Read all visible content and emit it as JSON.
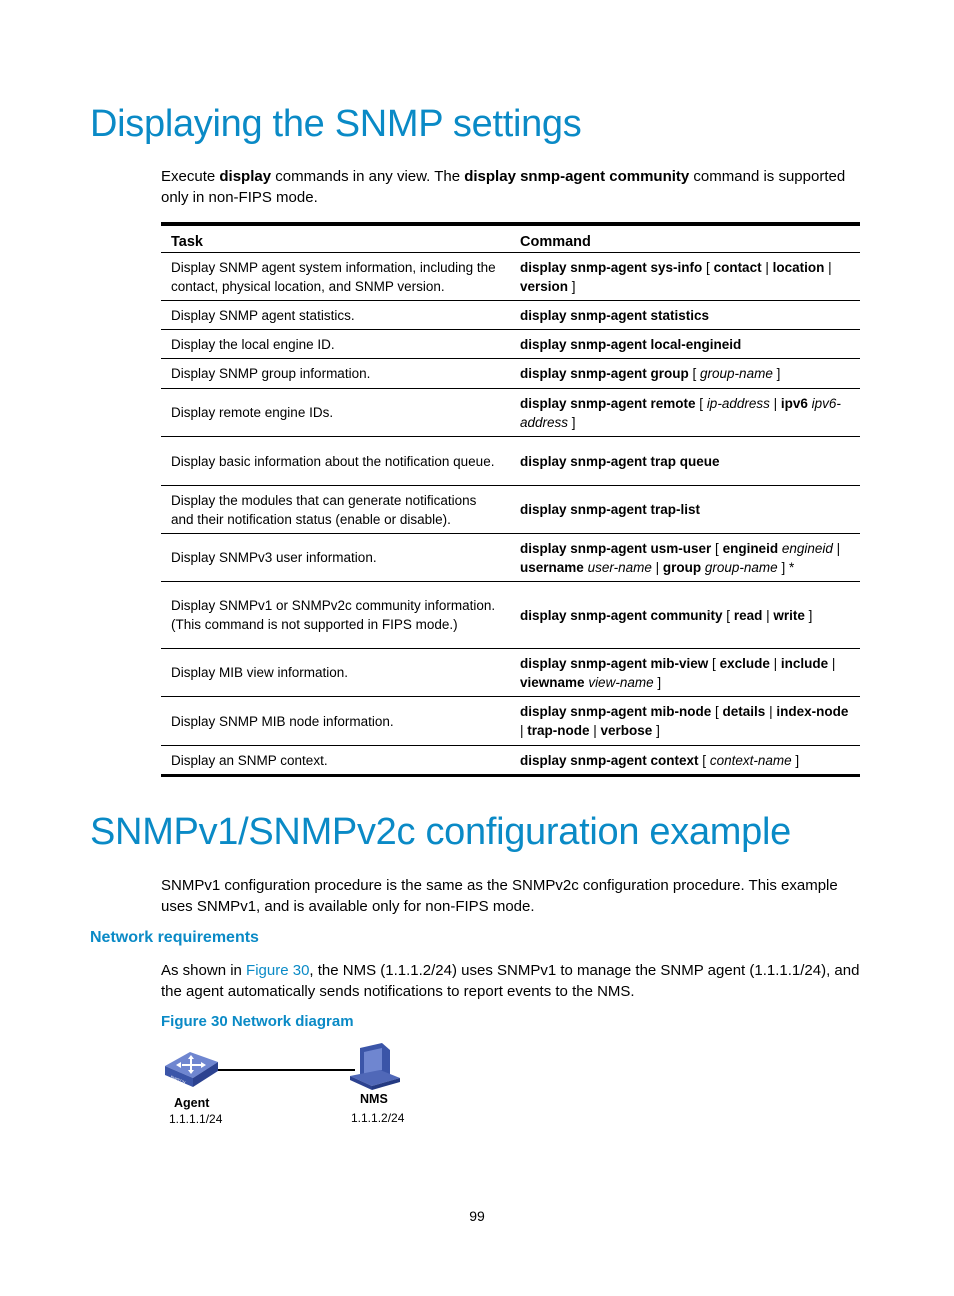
{
  "section1": {
    "title": "Displaying the SNMP settings",
    "intro": {
      "p1": "Execute ",
      "b1": "display",
      "p2": " commands in any view. The ",
      "b2": "display snmp-agent community",
      "p3": " command is supported only in non-FIPS mode."
    },
    "table": {
      "headers": [
        "Task",
        "Command"
      ],
      "rows": [
        {
          "task": "Display SNMP agent system information, including the contact, physical location, and SNMP version.",
          "cmd": [
            [
              "b",
              "display snmp-agent sys-info"
            ],
            [
              "t",
              " [ "
            ],
            [
              "b",
              "contact"
            ],
            [
              "t",
              " | "
            ],
            [
              "b",
              "location"
            ],
            [
              "t",
              " | "
            ],
            [
              "b",
              "version"
            ],
            [
              "t",
              " ]"
            ]
          ]
        },
        {
          "task": "Display SNMP agent statistics.",
          "cmd": [
            [
              "b",
              "display snmp-agent statistics"
            ]
          ]
        },
        {
          "task": "Display the local engine ID.",
          "cmd": [
            [
              "b",
              "display snmp-agent local-engineid"
            ]
          ]
        },
        {
          "task": "Display SNMP group information.",
          "cmd": [
            [
              "b",
              "display snmp-agent group"
            ],
            [
              "t",
              " [ "
            ],
            [
              "i",
              "group-name"
            ],
            [
              "t",
              " ]"
            ]
          ]
        },
        {
          "task": "Display remote engine IDs.",
          "cmd": [
            [
              "b",
              "display snmp-agent remote"
            ],
            [
              "t",
              " [ "
            ],
            [
              "i",
              "ip-address"
            ],
            [
              "t",
              " | "
            ],
            [
              "b",
              "ipv6"
            ],
            [
              "t",
              " "
            ],
            [
              "i",
              "ipv6-address"
            ],
            [
              "t",
              " ]"
            ]
          ]
        },
        {
          "task": "Display basic information about the notification queue.",
          "cmd": [
            [
              "b",
              "display snmp-agent trap queue"
            ]
          ]
        },
        {
          "task": "Display the modules that can generate notifications and their notification status (enable or disable).",
          "cmd": [
            [
              "b",
              "display snmp-agent trap-list"
            ]
          ]
        },
        {
          "task": "Display SNMPv3 user information.",
          "cmd": [
            [
              "b",
              "display snmp-agent usm-user"
            ],
            [
              "t",
              " [ "
            ],
            [
              "b",
              "engineid"
            ],
            [
              "t",
              " "
            ],
            [
              "i",
              "engineid"
            ],
            [
              "t",
              " | "
            ],
            [
              "b",
              "username"
            ],
            [
              "t",
              " "
            ],
            [
              "i",
              "user-name"
            ],
            [
              "t",
              " | "
            ],
            [
              "b",
              "group"
            ],
            [
              "t",
              " "
            ],
            [
              "i",
              "group-name"
            ],
            [
              "t",
              " ] *"
            ]
          ]
        },
        {
          "task": "Display SNMPv1 or SNMPv2c community information. (This command is not supported in FIPS mode.)",
          "cmd": [
            [
              "b",
              "display snmp-agent community"
            ],
            [
              "t",
              " [ "
            ],
            [
              "b",
              "read"
            ],
            [
              "t",
              " | "
            ],
            [
              "b",
              "write"
            ],
            [
              "t",
              " ]"
            ]
          ]
        },
        {
          "task": "Display MIB view information.",
          "cmd": [
            [
              "b",
              "display snmp-agent mib-view"
            ],
            [
              "t",
              " [ "
            ],
            [
              "b",
              "exclude"
            ],
            [
              "t",
              " | "
            ],
            [
              "b",
              "include"
            ],
            [
              "t",
              " | "
            ],
            [
              "b",
              "viewname"
            ],
            [
              "t",
              " "
            ],
            [
              "i",
              "view-name"
            ],
            [
              "t",
              " ]"
            ]
          ]
        },
        {
          "task": "Display SNMP MIB node information.",
          "cmd": [
            [
              "b",
              "display snmp-agent mib-node"
            ],
            [
              "t",
              " [ "
            ],
            [
              "b",
              "details"
            ],
            [
              "t",
              " | "
            ],
            [
              "b",
              "index-node"
            ],
            [
              "t",
              " | "
            ],
            [
              "b",
              "trap-node"
            ],
            [
              "t",
              " | "
            ],
            [
              "b",
              "verbose"
            ],
            [
              "t",
              " ]"
            ]
          ]
        },
        {
          "task": "Display an SNMP context.",
          "cmd": [
            [
              "b",
              "display snmp-agent context"
            ],
            [
              "t",
              " [ "
            ],
            [
              "i",
              "context-name"
            ],
            [
              "t",
              " ]"
            ]
          ]
        }
      ]
    }
  },
  "section2": {
    "title": "SNMPv1/SNMPv2c configuration example",
    "intro": "SNMPv1 configuration procedure is the same as the SNMPv2c configuration procedure. This example uses SNMPv1, and is available only for non-FIPS mode.",
    "subheading": "Network requirements",
    "req": {
      "p1": "As shown in ",
      "link": "Figure 30",
      "p2": ", the NMS (1.1.1.2/24) uses SNMPv1 to manage the SNMP agent (1.1.1.1/24), and the agent automatically sends notifications to report events to the NMS."
    },
    "figure_caption": "Figure 30 Network diagram",
    "diagram": {
      "agent_label": "Agent",
      "agent_ip": "1.1.1.1/24",
      "nms_label": "NMS",
      "nms_ip": "1.1.1.2/24",
      "switch_text": "SWITCH",
      "icons": [
        "switch-icon",
        "computer-icon"
      ],
      "colors": {
        "device": "#3b55a8",
        "device_light": "#6f86d0",
        "line": "#000000"
      }
    }
  },
  "colors": {
    "accent": "#0a8ac6"
  },
  "page_number": "99"
}
